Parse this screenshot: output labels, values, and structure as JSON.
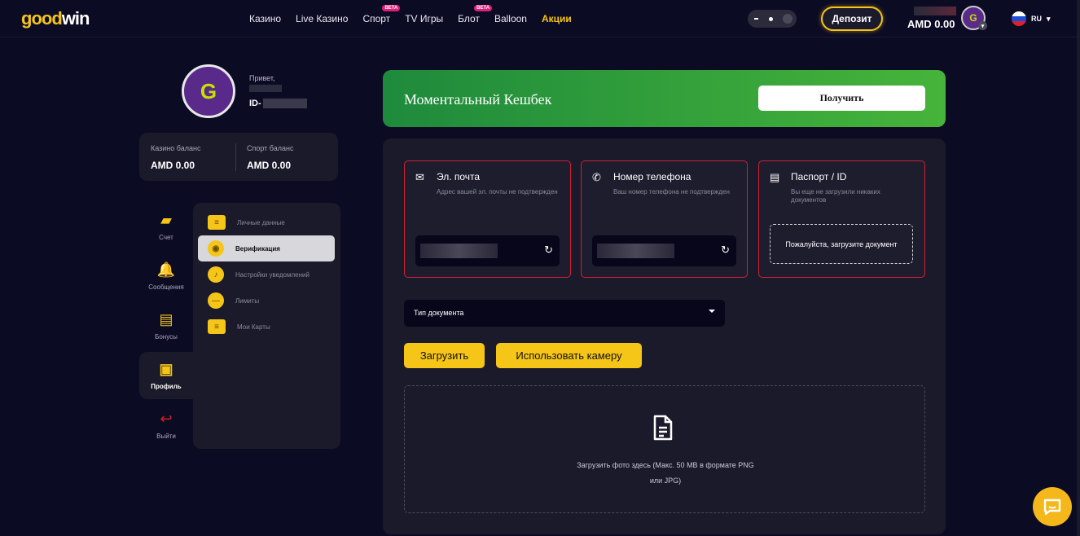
{
  "header": {
    "logo_a": "good",
    "logo_b": "win",
    "nav": [
      {
        "label": "Казино"
      },
      {
        "label": "Live Казино"
      },
      {
        "label": "Спорт",
        "badge": "BETA"
      },
      {
        "label": "TV Игры"
      },
      {
        "label": "Блот",
        "badge": "BETA"
      },
      {
        "label": "Balloon"
      },
      {
        "label": "Акции"
      }
    ],
    "deposit_label": "Депозит",
    "balance": "AMD  0.00",
    "language": "RU",
    "accent_color": "#f5c518"
  },
  "profile": {
    "greeting": "Привет,",
    "id_prefix": "ID-",
    "casino_balance_label": "Казино баланс",
    "casino_balance": "AMD 0.00",
    "sport_balance_label": "Спорт баланс",
    "sport_balance": "AMD 0.00"
  },
  "side_rail": [
    {
      "label": "Счет",
      "icon": "wallet-icon"
    },
    {
      "label": "Сообщения",
      "icon": "bell-icon"
    },
    {
      "label": "Бонусы",
      "icon": "ticket-icon"
    },
    {
      "label": "Профиль",
      "icon": "id-card-icon",
      "active": true
    },
    {
      "label": "Выйти",
      "icon": "logout-icon"
    }
  ],
  "submenu": [
    {
      "label": "Личные данные",
      "icon": "id-card-icon"
    },
    {
      "label": "Верификация",
      "icon": "verification-icon",
      "active": true
    },
    {
      "label": "Настройки уведомлений",
      "icon": "bell-icon"
    },
    {
      "label": "Лимиты",
      "icon": "minus-circle-icon"
    },
    {
      "label": "Мои Карты",
      "icon": "card-icon"
    }
  ],
  "cashback": {
    "title": "Моментальный Кешбек",
    "button": "Получить",
    "gradient": [
      "#1e8a3c",
      "#46b43a"
    ]
  },
  "verification": {
    "email": {
      "title": "Эл. почта",
      "desc": "Адрес вашей эл. почты не подтвержден",
      "icon": "mail-icon"
    },
    "phone": {
      "title": "Номер телефона",
      "desc": "Ваш номер телефона не подтвержден",
      "icon": "phone-icon"
    },
    "passport": {
      "title": "Паспорт / ID",
      "desc": "Вы еще не загрузили никаких документов",
      "icon": "document-icon",
      "upload_prompt": "Пожалуйста, загрузите документ"
    },
    "status_color": "#d21f35"
  },
  "upload": {
    "doc_type_placeholder": "Тип документа",
    "upload_button": "Загрузить",
    "camera_button": "Использовать камеру",
    "drop_text_1": "Загрузить фото здесь (Макс. 50 MB в формате PNG",
    "drop_text_2": "или JPG)"
  }
}
